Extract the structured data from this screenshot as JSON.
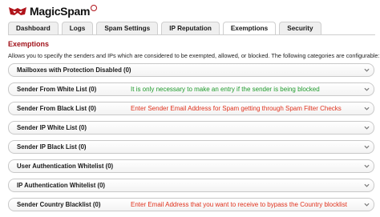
{
  "app": {
    "name": "MagicSpam"
  },
  "tabs": [
    {
      "label": "Dashboard"
    },
    {
      "label": "Logs"
    },
    {
      "label": "Spam Settings"
    },
    {
      "label": "IP Reputation"
    },
    {
      "label": "Exemptions",
      "active": true
    },
    {
      "label": "Security"
    }
  ],
  "page": {
    "title": "Exemptions",
    "description": "Allows you to specify the senders and IPs which are considered to be exempted, allowed, or blocked. The following categories are configurable:"
  },
  "sections": [
    {
      "label": "Mailboxes with Protection Disabled (0)",
      "note": ""
    },
    {
      "label": "Sender From White List (0)",
      "note": "It is only necessary to make an entry if the sender is being blocked",
      "note_color": "green"
    },
    {
      "label": "Sender From Black List (0)",
      "note": "Enter Sender Email Address for Spam getting through Spam Filter Checks",
      "note_color": "red"
    },
    {
      "label": "Sender IP White List (0)",
      "note": ""
    },
    {
      "label": "Sender IP Black List (0)",
      "note": ""
    },
    {
      "label": "User Authentication Whitelist (0)",
      "note": ""
    },
    {
      "label": "IP Authentication Whitelist (0)",
      "note": ""
    },
    {
      "label": "Sender Country Blacklist (0)",
      "note": "Enter Email Address that you want to receive to bypass the  Country blocklist",
      "note_color": "red"
    }
  ],
  "colors": {
    "brand": "#a0121a",
    "note_green": "#1f9b2c",
    "note_red": "#e0321d"
  }
}
